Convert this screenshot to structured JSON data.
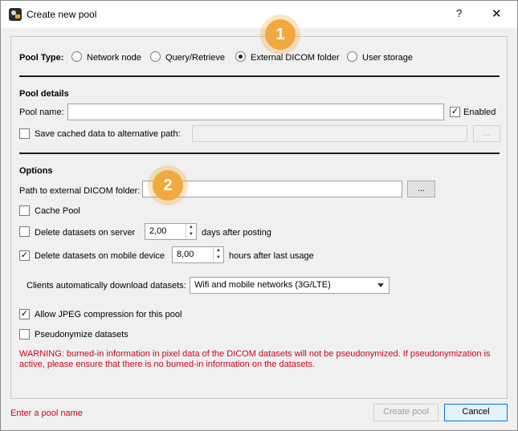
{
  "window": {
    "title": "Create new pool",
    "help_label": "?",
    "close_label": "✕"
  },
  "pool_type": {
    "label": "Pool Type:",
    "options": [
      "Network node",
      "Query/Retrieve",
      "External DICOM folder",
      "User storage"
    ],
    "selected": "External DICOM folder"
  },
  "pool_details": {
    "heading": "Pool details",
    "name_label": "Pool name:",
    "name_value": "",
    "enabled_label": "Enabled",
    "enabled_checked": true,
    "alt_path_label": "Save cached data to alternative path:",
    "alt_path_checked": false,
    "alt_path_value": "",
    "browse_label": "..."
  },
  "options": {
    "heading": "Options",
    "path_label": "Path to external DICOM folder:",
    "path_value": "",
    "browse_label": "...",
    "cache_pool_label": "Cache Pool",
    "cache_pool_checked": false,
    "delete_server_label": "Delete datasets on server",
    "delete_server_checked": false,
    "delete_server_value": "2,00",
    "delete_server_suffix": "days after posting",
    "delete_mobile_label": "Delete datasets on mobile device",
    "delete_mobile_checked": true,
    "delete_mobile_value": "8,00",
    "delete_mobile_suffix": "hours after last usage",
    "auto_download_label": "Clients automatically download datasets:",
    "auto_download_value": "Wifi and mobile networks (3G/LTE)",
    "jpeg_label": "Allow JPEG compression for this pool",
    "jpeg_checked": true,
    "pseudonymize_label": "Pseudonymize datasets",
    "pseudonymize_checked": false,
    "warning_line1": "WARNING: burned-in information in pixel data of the DICOM datasets will not be pseudonymized. If pseudonymization is",
    "warning_line2": "active, please ensure that there is no burned-in information on the datasets."
  },
  "footer": {
    "status": "Enter a pool name",
    "create_label": "Create pool",
    "cancel_label": "Cancel"
  },
  "callouts": [
    "1",
    "2"
  ],
  "colors": {
    "warning": "#d0021b",
    "callout": "#f0a940",
    "default_button_border": "#0078d7"
  }
}
